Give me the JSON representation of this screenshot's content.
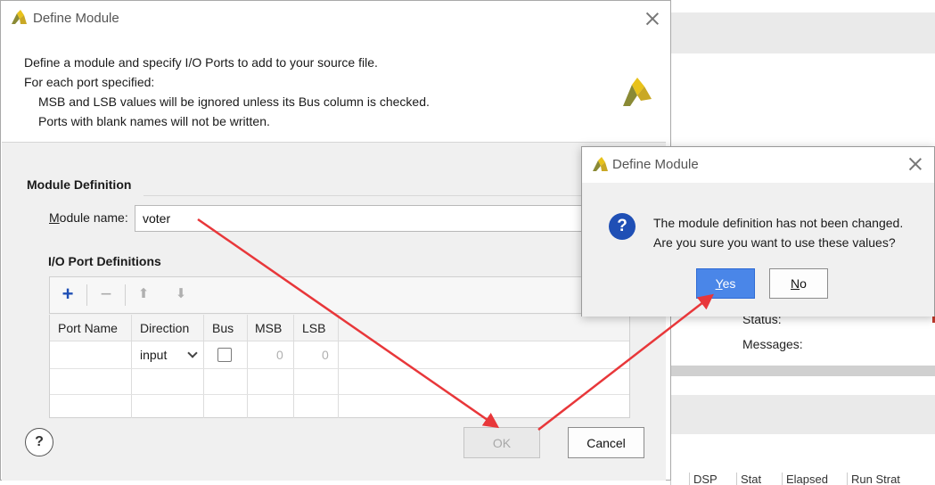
{
  "background": {
    "fields": [
      "Status:",
      "Messages:"
    ],
    "columns": [
      "",
      "DSP",
      "Stat",
      "Elapsed",
      "Run Strat"
    ]
  },
  "main_dialog": {
    "title": "Define Module",
    "description": [
      "Define a module and specify I/O Ports to add to your source file.",
      "For each port specified:",
      "MSB and LSB values will be ignored unless its Bus column is checked.",
      "Ports with blank names will not be written."
    ],
    "module_section_title": "Module Definition",
    "module_name_label_mnemonic": "M",
    "module_name_label_rest": "odule name:",
    "module_name_value": "voter",
    "io_section_title": "I/O Port Definitions",
    "toolbar": {
      "add": "+",
      "remove": "−",
      "move_up": "⬆",
      "move_down": "⬇"
    },
    "table": {
      "headers": [
        "Port Name",
        "Direction",
        "Bus",
        "MSB",
        "LSB"
      ],
      "rows": [
        {
          "port_name": "",
          "direction": "input",
          "bus": false,
          "msb": "0",
          "lsb": "0"
        }
      ]
    },
    "help_label": "?",
    "ok_label": "OK",
    "cancel_label": "Cancel"
  },
  "confirm_dialog": {
    "title": "Define Module",
    "message_line1": "The module definition has not been changed.",
    "message_line2": "Are you sure you want to use these values?",
    "icon": "?",
    "yes_mnemonic": "Y",
    "yes_rest": "es",
    "no_mnemonic": "N",
    "no_rest": "o"
  },
  "colors": {
    "accent": "#4a86e8",
    "logo_yellow": "#e8c21a",
    "logo_dark": "#8a8a35",
    "arrow": "#e8373a"
  }
}
